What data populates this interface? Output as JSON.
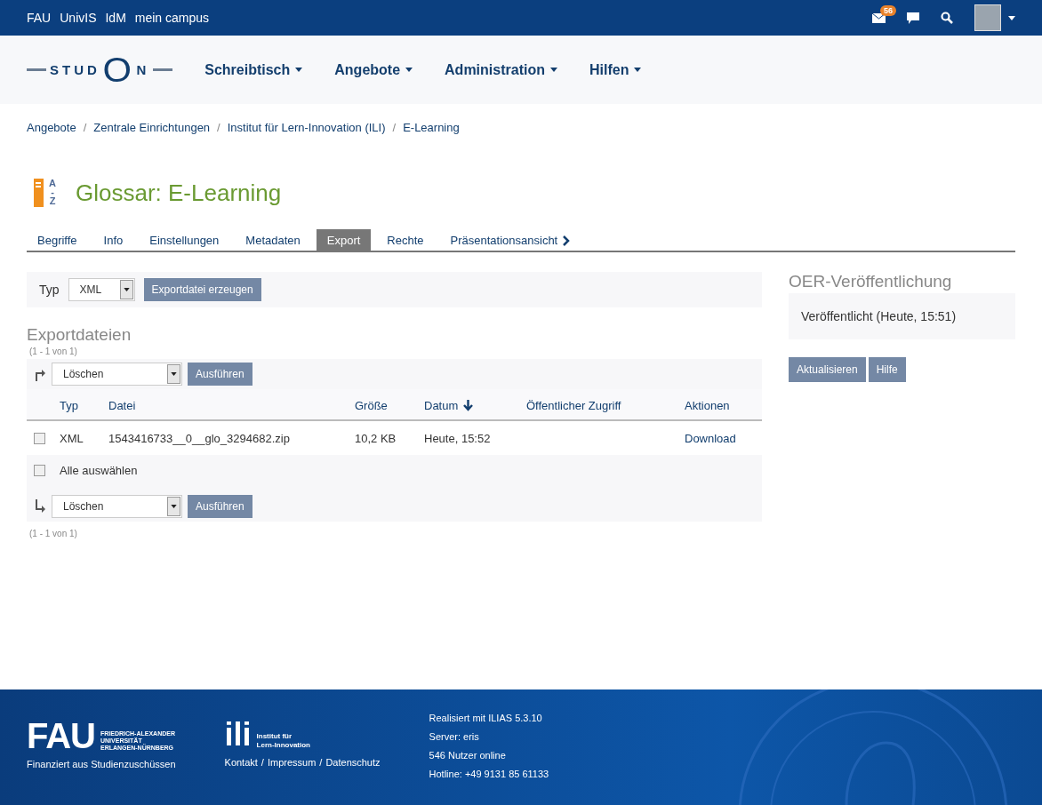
{
  "top_bar": {
    "links": [
      "FAU",
      "UnivIS",
      "IdM",
      "mein campus"
    ],
    "mail_badge": "56"
  },
  "header": {
    "logo": "STUDON",
    "menu": [
      "Schreibtisch",
      "Angebote",
      "Administration",
      "Hilfen"
    ]
  },
  "breadcrumb": {
    "items": [
      "Angebote",
      "Zentrale Einrichtungen",
      "Institut für Lern-Innovation (ILI)",
      "E-Learning"
    ],
    "separator": "/"
  },
  "page": {
    "icon_letters": [
      "A",
      "-",
      "Z"
    ],
    "title": "Glossar: E-Learning"
  },
  "tabs": [
    {
      "label": "Begriffe",
      "selected": false
    },
    {
      "label": "Info",
      "selected": false
    },
    {
      "label": "Einstellungen",
      "selected": false
    },
    {
      "label": "Metadaten",
      "selected": false
    },
    {
      "label": "Export",
      "selected": true
    },
    {
      "label": "Rechte",
      "selected": false
    },
    {
      "label": "Präsentationsansicht",
      "selected": false,
      "chevron": true
    }
  ],
  "export_form": {
    "label": "Typ",
    "select": "XML",
    "button": "Exportdatei erzeugen"
  },
  "export_files": {
    "title": "Exportdateien",
    "count_top": "(1 - 1 von 1)",
    "top_action": {
      "select": "Löschen",
      "button": "Ausführen"
    },
    "columns": [
      {
        "label": "Typ",
        "sorted": false
      },
      {
        "label": "Datei",
        "sorted": false
      },
      {
        "label": "Größe",
        "sorted": false
      },
      {
        "label": "Datum",
        "sorted": true
      },
      {
        "label": "Öffentlicher Zugriff",
        "sorted": false
      },
      {
        "label": "Aktionen",
        "sorted": false
      }
    ],
    "rows": [
      {
        "checked": false,
        "type": "XML",
        "file": "1543416733__0__glo_3294682.zip",
        "size": "10,2 KB",
        "date": "Heute, 15:52",
        "access": null,
        "action": "Download"
      }
    ],
    "select_all": {
      "label": "Alle auswählen",
      "checked": false
    },
    "bottom_action": {
      "select": "Löschen",
      "button": "Ausführen"
    },
    "count_bottom": "(1 - 1 von 1)"
  },
  "sidebar": {
    "title": "OER-Veröffentlichung",
    "status": "Veröffentlicht (Heute, 15:51)",
    "buttons": [
      "Aktualisieren",
      "Hilfe"
    ]
  },
  "footer": {
    "fau_logo": "FAU",
    "fau_name": [
      "FRIEDRICH-ALEXANDER",
      "UNIVERSITÄT",
      "ERLANGEN-NÜRNBERG"
    ],
    "funding": "Finanziert aus Studienzuschüssen",
    "ili_logo": "ili",
    "ili_name": [
      "Institut für",
      "Lern-Innovation"
    ],
    "links": [
      "Kontakt",
      "Impressum",
      "Datenschutz"
    ],
    "separator": "/",
    "info": [
      "Realisiert mit ILIAS 5.3.10",
      "Server: eris",
      "546 Nutzer online",
      "Hotline: +49 9131 85 61133"
    ]
  }
}
